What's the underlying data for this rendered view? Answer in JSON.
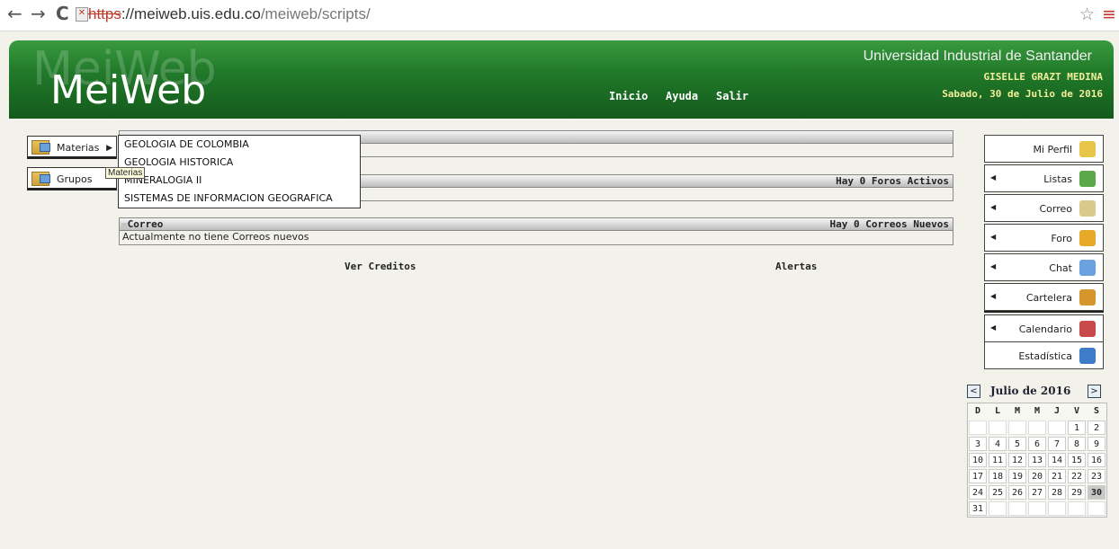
{
  "browser": {
    "back": "←",
    "forward": "→",
    "reload": "C",
    "url_scheme": "https",
    "url_host": "://meiweb.uis.edu.co",
    "url_path": "/meiweb/scripts/"
  },
  "header": {
    "logo_ghost": "MeiWeb",
    "logo": "MeiWeb",
    "nav": [
      "Inicio",
      "Ayuda",
      "Salir"
    ],
    "university": "Universidad Industrial de Santander",
    "user": "GISELLE GRAZT MEDINA",
    "date": "Sabado, 30 de Julio de 2016"
  },
  "left_menu": {
    "materias": "Materias",
    "grupos": "Grupos",
    "tooltip": "Materias",
    "dropdown": [
      "GEOLOGIA DE COLOMBIA",
      "GEOLOGIA HISTORICA",
      "MINERALOGIA II",
      "SISTEMAS DE INFORMACION GEOGRAFICA"
    ]
  },
  "main": {
    "foros_status": "Hay 0 Foros Activos",
    "correo_title": "Correo",
    "correo_status": "Hay 0 Correos Nuevos",
    "correo_message": "Actualmente no tiene Correos nuevos",
    "ver_creditos": "Ver Creditos",
    "alertas": "Alertas"
  },
  "sidebar": {
    "items": [
      {
        "label": "Mi Perfil",
        "arrow": false,
        "icon": "profile-icon",
        "color": "#e8c64a"
      },
      {
        "label": "Listas",
        "arrow": true,
        "icon": "list-icon",
        "color": "#5aa84a"
      },
      {
        "label": "Correo",
        "arrow": true,
        "icon": "mail-icon",
        "color": "#d9c98a"
      },
      {
        "label": "Foro",
        "arrow": true,
        "icon": "pencil-icon",
        "color": "#e8a92a"
      },
      {
        "label": "Chat",
        "arrow": true,
        "icon": "chat-icon",
        "color": "#6aa2e0"
      },
      {
        "label": "Cartelera",
        "arrow": true,
        "icon": "board-icon",
        "color": "#d6962c"
      },
      {
        "label": "Calendario",
        "arrow": true,
        "icon": "calendar-icon",
        "color": "#c94a4a"
      },
      {
        "label": "Estadística",
        "arrow": false,
        "icon": "stats-icon",
        "color": "#3d7cc9"
      }
    ]
  },
  "calendar": {
    "title": "Julio de 2016",
    "prev": "<",
    "next": ">",
    "days_of_week": [
      "D",
      "L",
      "M",
      "M",
      "J",
      "V",
      "S"
    ],
    "weeks": [
      [
        "",
        "",
        "",
        "",
        "",
        "1",
        "2"
      ],
      [
        "3",
        "4",
        "5",
        "6",
        "7",
        "8",
        "9"
      ],
      [
        "10",
        "11",
        "12",
        "13",
        "14",
        "15",
        "16"
      ],
      [
        "17",
        "18",
        "19",
        "20",
        "21",
        "22",
        "23"
      ],
      [
        "24",
        "25",
        "26",
        "27",
        "28",
        "29",
        "30"
      ],
      [
        "31",
        "",
        "",
        "",
        "",
        "",
        ""
      ]
    ],
    "today": "30"
  }
}
